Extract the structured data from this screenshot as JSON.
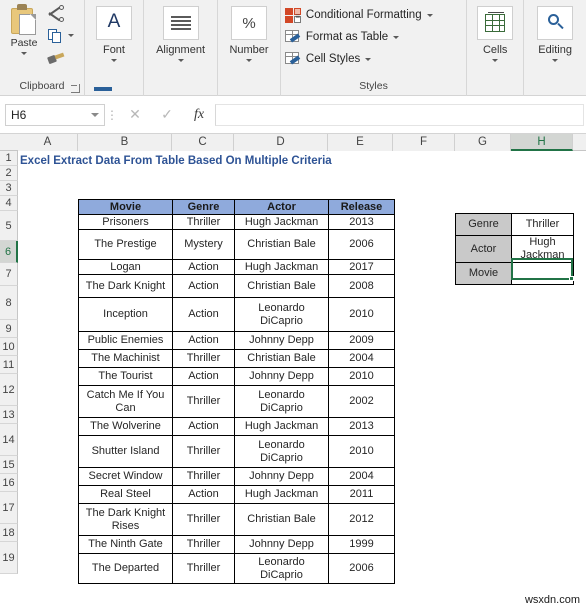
{
  "ribbon": {
    "clipboard": {
      "paste_label": "Paste",
      "group_label": "Clipboard",
      "cut_icon": "scissors-icon",
      "copy_icon": "copy-icon",
      "format_painter_icon": "format-painter-icon",
      "dialog_launcher_icon": "dialog-launcher-icon"
    },
    "font": {
      "label": "Font",
      "icon": "font-a-icon"
    },
    "alignment": {
      "label": "Alignment",
      "icon": "alignment-lines-icon"
    },
    "number": {
      "label": "Number",
      "icon": "percent-icon"
    },
    "styles": {
      "group_label": "Styles",
      "items": [
        {
          "label": "Conditional Formatting",
          "icon": "conditional-formatting-icon"
        },
        {
          "label": "Format as Table",
          "icon": "format-as-table-icon"
        },
        {
          "label": "Cell Styles",
          "icon": "cell-styles-icon"
        }
      ]
    },
    "cells": {
      "label": "Cells",
      "icon": "cells-grid-icon"
    },
    "editing": {
      "label": "Editing",
      "icon": "magnifier-icon"
    }
  },
  "formula_bar": {
    "name_box_value": "H6",
    "cancel_icon": "close-icon",
    "enter_icon": "check-icon",
    "function_icon": "fx-icon",
    "formula_value": ""
  },
  "grid": {
    "columns": [
      "A",
      "B",
      "C",
      "D",
      "E",
      "F",
      "G",
      "H"
    ],
    "selected_column": "H",
    "rows": [
      "1",
      "2",
      "3",
      "4",
      "5",
      "6",
      "7",
      "8",
      "9",
      "10",
      "11",
      "12",
      "13",
      "14",
      "15",
      "16",
      "17",
      "18",
      "19"
    ],
    "selected_row": "6",
    "title_cell": "Excel Extract Data From Table Based On Multiple Criteria"
  },
  "table": {
    "headers": [
      "Movie",
      "Genre",
      "Actor",
      "Release"
    ],
    "rows": [
      {
        "movie": "Prisoners",
        "genre": "Thriller",
        "actor": "Hugh Jackman",
        "release": "2013"
      },
      {
        "movie": "The Prestige",
        "genre": "Mystery",
        "actor": "Christian Bale",
        "release": "2006"
      },
      {
        "movie": "Logan",
        "genre": "Action",
        "actor": "Hugh Jackman",
        "release": "2017"
      },
      {
        "movie": "The Dark Knight",
        "genre": "Action",
        "actor": "Christian Bale",
        "release": "2008"
      },
      {
        "movie": "Inception",
        "genre": "Action",
        "actor": "Leonardo DiCaprio",
        "release": "2010"
      },
      {
        "movie": "Public Enemies",
        "genre": "Action",
        "actor": "Johnny Depp",
        "release": "2009"
      },
      {
        "movie": "The Machinist",
        "genre": "Thriller",
        "actor": "Christian Bale",
        "release": "2004"
      },
      {
        "movie": "The Tourist",
        "genre": "Action",
        "actor": "Johnny Depp",
        "release": "2010"
      },
      {
        "movie": "Catch Me If You Can",
        "genre": "Thriller",
        "actor": "Leonardo DiCaprio",
        "release": "2002"
      },
      {
        "movie": "The Wolverine",
        "genre": "Action",
        "actor": "Hugh Jackman",
        "release": "2013"
      },
      {
        "movie": "Shutter Island",
        "genre": "Thriller",
        "actor": "Leonardo DiCaprio",
        "release": "2010"
      },
      {
        "movie": "Secret Window",
        "genre": "Thriller",
        "actor": "Johnny Depp",
        "release": "2004"
      },
      {
        "movie": "Real Steel",
        "genre": "Action",
        "actor": "Hugh Jackman",
        "release": "2011"
      },
      {
        "movie": "The Dark Knight Rises",
        "genre": "Thriller",
        "actor": "Christian Bale",
        "release": "2012"
      },
      {
        "movie": "The Ninth Gate",
        "genre": "Thriller",
        "actor": "Johnny Depp",
        "release": "1999"
      },
      {
        "movie": "The Departed",
        "genre": "Thriller",
        "actor": "Leonardo DiCaprio",
        "release": "2006"
      }
    ]
  },
  "criteria": {
    "rows": [
      {
        "label": "Genre",
        "value": "Thriller"
      },
      {
        "label": "Actor",
        "value": "Hugh Jackman"
      },
      {
        "label": "Movie",
        "value": ""
      }
    ]
  },
  "watermark": "wsxdn.com",
  "colors": {
    "header_fill": "#8faadc",
    "criteria_label_fill": "#c9c9c9",
    "title_text": "#2e5395",
    "selection_green": "#217346"
  }
}
